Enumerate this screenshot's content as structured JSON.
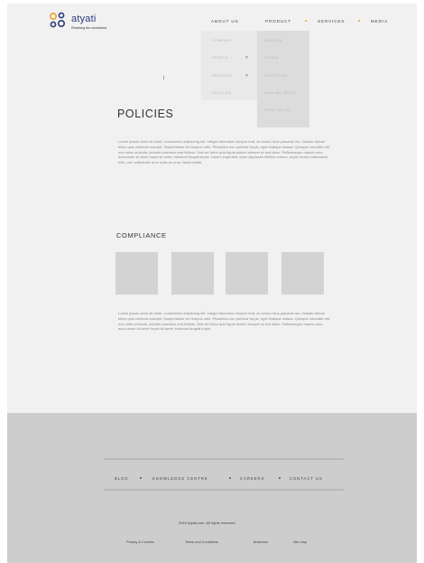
{
  "brand": {
    "name": "atyati",
    "tagline": "Reaching the unreached"
  },
  "nav": {
    "items": [
      "ABOUT US",
      "PRODUCT",
      "SERVICES",
      "MEDIA"
    ]
  },
  "dropdown": {
    "col1": [
      "COMPANY",
      "PEOPLE",
      "PROCESS",
      "POLICIES"
    ],
    "col2": [
      "MISSION",
      "VISION",
      "INCEPTION",
      "HOW WE WORK",
      "WHAT WE DO"
    ],
    "arrow": ">"
  },
  "policies": {
    "title": "POLICIES",
    "text": "Lorem ipsum dolor sit amet, consectetur adipiscing elit. Integer bibendum tempor erat, ac luctus risus placerat nec. Nullam dictum tellus quis vehicula suscipit. Suspendisse vel tempus odio. Phasellus non pulvinar turpis, eget tristique massa. Quisque convallis nisl non nulla vehicula, lobortis maximus erat finibus. Sed vel tortor quis ligula dictum semper at sed diam. Pellentesque mauris arcu, accumsan sit amet turpis sit amet, euismod feugiat turpis. Donec imperdiet, dolor dignissim efficitur rutrum, turpis lectus malesuada nibh, non sollicitudin arcu nulla ac urna. Nulla facilisi."
  },
  "compliance": {
    "title": "COMPLIANCE",
    "text": "Lorem ipsum dolor sit amet, consectetur adipiscing elit. Integer bibendum tempor erat, ac luctus risus placerat nec. Nullam dictum tellus quis vehicula suscipit. Suspendisse vel tempus odio. Phasellus non pulvinar turpis, eget tristique massa. Quisque convallis nisl non nulla vehicula, lobortis maximus erat finibus. Sed vel tortor quis ligula dictum semper at sed diam. Pellentesque mauris arcu, accu-msan sit amet turpis sit amet, euismod feugiat turpis."
  },
  "footer": {
    "nav": [
      "BLOG",
      "KNOWLEDGE CENTRE",
      "CAREERS",
      "CONTACT US"
    ],
    "copyright": "2016 Atyati.com.  All rights reserved.",
    "links": [
      "Privacy & Cookies",
      "Terms and Conditions",
      "Branches",
      "Site map"
    ]
  },
  "colors": {
    "accent_dot": "#f0a52e",
    "brand_text": "#2b3a7a",
    "footer_bg": "#cdcdcd",
    "page_bg": "#f1f1f1"
  },
  "icons": {
    "logo": "atyati-logo-icon"
  }
}
